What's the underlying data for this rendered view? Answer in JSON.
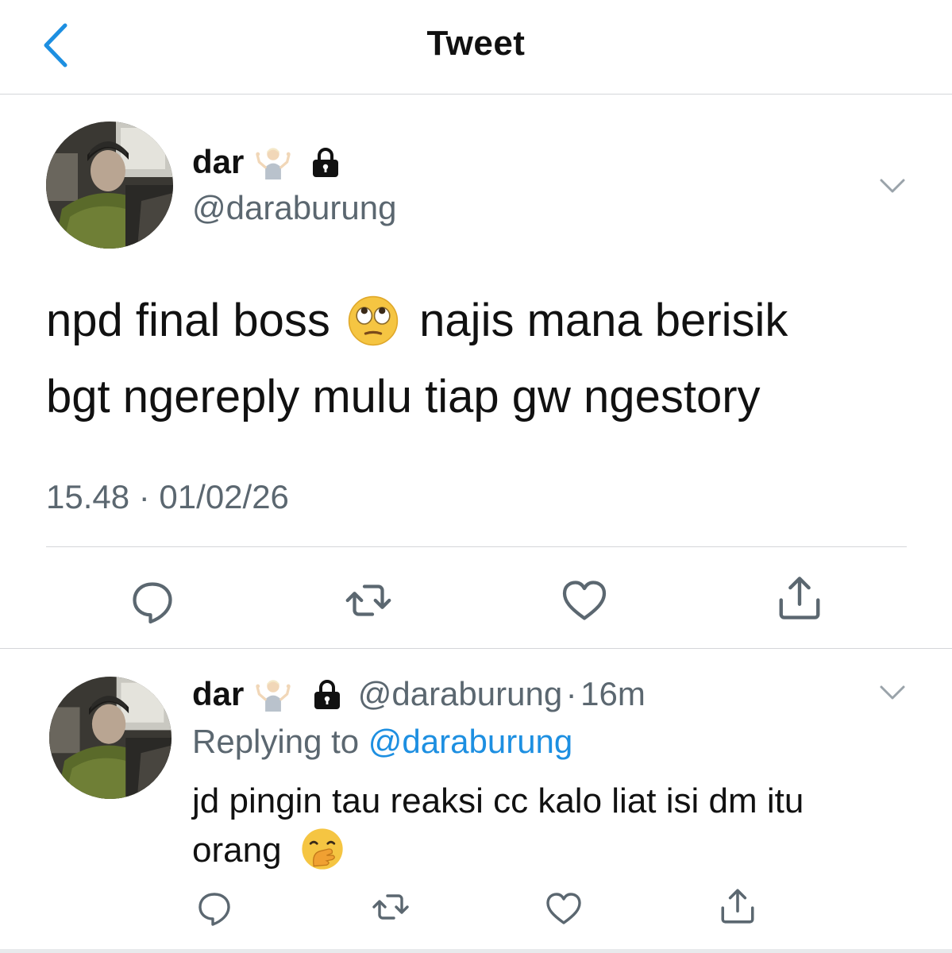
{
  "header": {
    "title": "Tweet",
    "back_icon": "chevron-left-icon"
  },
  "colors": {
    "accent": "#1d8fe1",
    "secondary_text": "#5b6770",
    "divider": "#d4d6d9",
    "lock": "#111111"
  },
  "main_tweet": {
    "display_name": "dar",
    "name_emoji": "person-shrugging-emoji",
    "lock_icon": "lock-icon",
    "handle": "@daraburung",
    "text_line1_a": "npd final boss",
    "text_emoji": "face-rolling-eyes-emoji",
    "text_line1_b": "najis mana berisik",
    "text_line2": "bgt ngereply mulu tiap gw ngestory",
    "timestamp": "15.48 · 01/02/26",
    "actions": [
      "reply-icon",
      "retweet-icon",
      "like-icon",
      "share-icon"
    ]
  },
  "reply_tweet": {
    "display_name": "dar",
    "name_emoji": "person-shrugging-emoji",
    "lock_icon": "lock-icon",
    "handle": "@daraburung",
    "separator": "·",
    "time": "16m",
    "replying_prefix": "Replying to",
    "replying_to": "@daraburung",
    "text_line1": "jd pingin tau reaksi cc kalo liat isi dm itu",
    "text_line2": "orang",
    "text_emoji": "face-with-hand-over-mouth-emoji",
    "actions": [
      "reply-icon",
      "retweet-icon",
      "like-icon",
      "share-icon"
    ]
  }
}
